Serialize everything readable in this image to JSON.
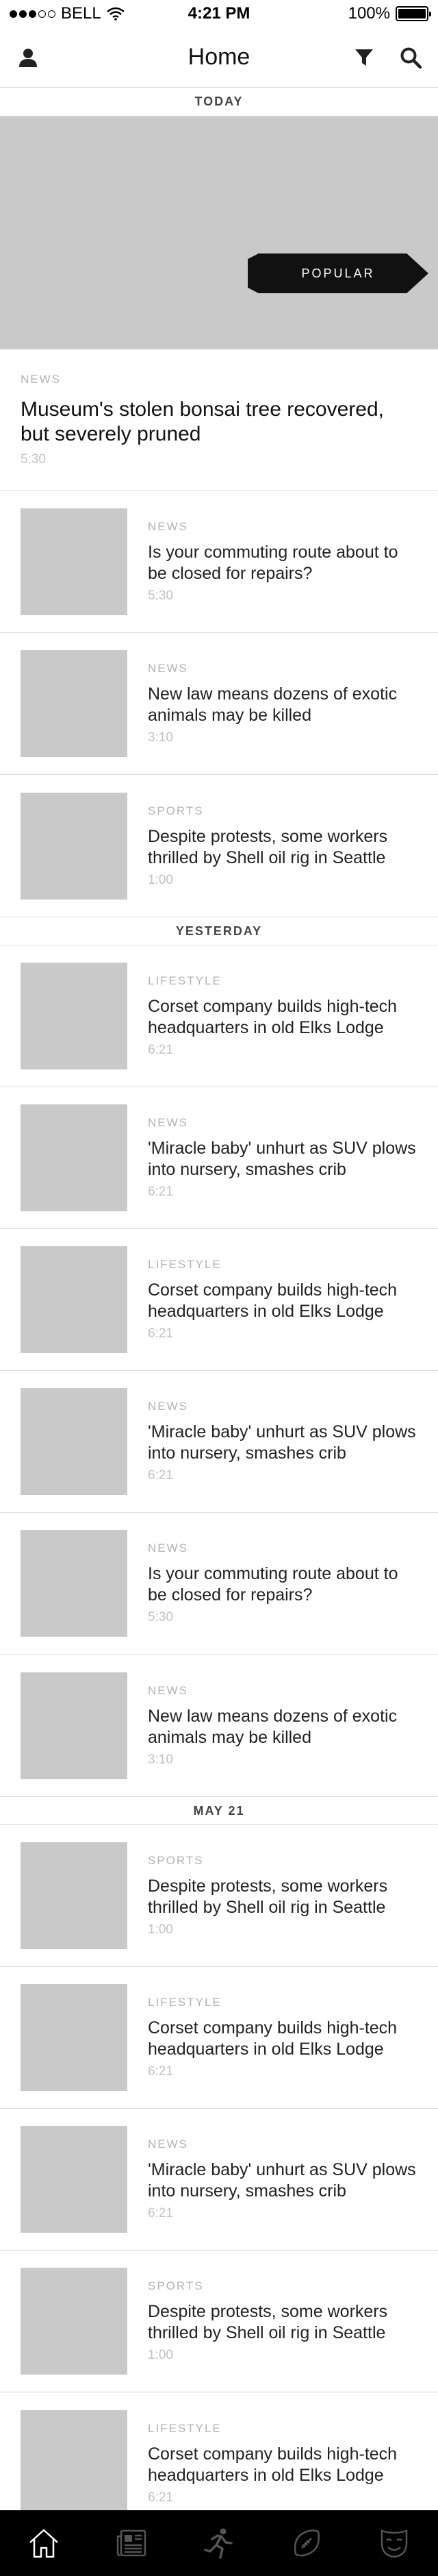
{
  "status_bar": {
    "carrier": "BELL",
    "time": "4:21 PM",
    "battery": "100%"
  },
  "nav": {
    "title": "Home",
    "icons": [
      "user-icon",
      "filter-icon",
      "search-icon"
    ]
  },
  "today": {
    "header": "TODAY",
    "badge": "POPULAR",
    "featured": {
      "category": "NEWS",
      "title": "Museum's stolen bonsai tree recovered, but severely pruned",
      "time": "5:30"
    },
    "items": [
      {
        "category": "NEWS",
        "title": "Is your commuting route about to be closed for repairs?",
        "time": "5:30"
      },
      {
        "category": "NEWS",
        "title": "New law means dozens of exotic animals may be killed",
        "time": "3:10"
      },
      {
        "category": "SPORTS",
        "title": "Despite protests, some workers thrilled by Shell oil rig in Seattle",
        "time": "1:00"
      }
    ]
  },
  "yesterday": {
    "header": "YESTERDAY",
    "items": [
      {
        "category": "LIFESTYLE",
        "title": "Corset company builds high-tech headquarters in old Elks Lodge",
        "time": "6:21"
      },
      {
        "category": "NEWS",
        "title": "'Miracle baby' unhurt as SUV plows into nursery, smashes crib",
        "time": "6:21"
      },
      {
        "category": "LIFESTYLE",
        "title": "Corset company builds high-tech headquarters in old Elks Lodge",
        "time": "6:21"
      },
      {
        "category": "NEWS",
        "title": "'Miracle baby' unhurt as SUV plows into nursery, smashes crib",
        "time": "6:21"
      },
      {
        "category": "NEWS",
        "title": "Is your commuting route about to be closed for repairs?",
        "time": "5:30"
      },
      {
        "category": "NEWS",
        "title": "New law means dozens of exotic animals may be killed",
        "time": "3:10"
      }
    ]
  },
  "may21": {
    "header": "MAY 21",
    "items": [
      {
        "category": "SPORTS",
        "title": "Despite protests, some workers thrilled by Shell oil rig in Seattle",
        "time": "1:00"
      },
      {
        "category": "LIFESTYLE",
        "title": "Corset company builds high-tech headquarters in old Elks Lodge",
        "time": "6:21"
      },
      {
        "category": "NEWS",
        "title": "'Miracle baby' unhurt as SUV plows into nursery, smashes crib",
        "time": "6:21"
      },
      {
        "category": "SPORTS",
        "title": "Despite protests, some workers thrilled by Shell oil rig in Seattle",
        "time": "1:00"
      },
      {
        "category": "LIFESTYLE",
        "title": "Corset company builds high-tech headquarters in old Elks Lodge",
        "time": "6:21"
      }
    ]
  },
  "tab_bar": {
    "tabs": [
      "home-icon",
      "news-icon",
      "sports-icon",
      "football-icon",
      "entertainment-icon"
    ],
    "background": "#000000"
  },
  "colors": {
    "thumbnail": "#c9c9c9",
    "kicker": "#b3b3b3",
    "divider": "#d9d9d9"
  }
}
